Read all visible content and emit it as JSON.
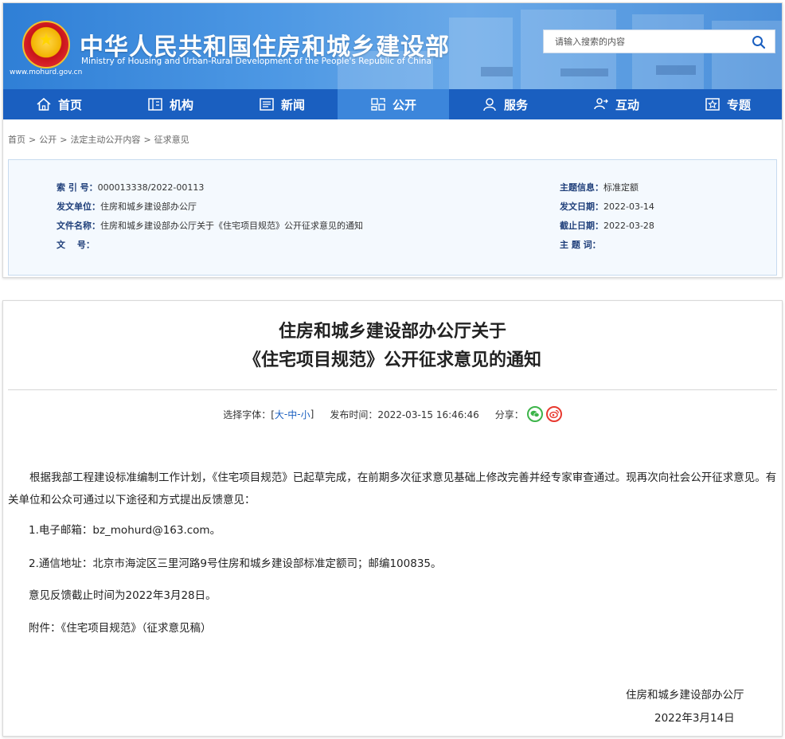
{
  "header": {
    "site_title": "中华人民共和国住房和城乡建设部",
    "site_title_en": "Ministry of Housing and Urban-Rural Development of the People's Republic of China",
    "site_url": "www.mohurd.gov.cn",
    "search_placeholder": "请输入搜索的内容",
    "search_icon": "search-icon"
  },
  "nav": {
    "items": [
      {
        "label": "首页",
        "icon": "home-icon"
      },
      {
        "label": "机构",
        "icon": "building-icon"
      },
      {
        "label": "新闻",
        "icon": "news-icon"
      },
      {
        "label": "公开",
        "icon": "public-icon",
        "active": true
      },
      {
        "label": "服务",
        "icon": "service-icon"
      },
      {
        "label": "互动",
        "icon": "interact-icon"
      },
      {
        "label": "专题",
        "icon": "topic-icon"
      }
    ],
    "active_color": "#3c86db",
    "bar_color": "#1a5fc0"
  },
  "breadcrumb": [
    "首页",
    "公开",
    "法定主动公开内容",
    "征求意见"
  ],
  "info": {
    "index_key": "索 引 号：",
    "index_value": "000013338/2022-00113",
    "topic_key": "主题信息：",
    "topic_value": "标准定额",
    "issuer_key": "发文单位：",
    "issuer_value": "住房和城乡建设部办公厅",
    "date_key": "发文日期：",
    "date_value": "2022-03-14",
    "docname_key": "文件名称：",
    "docname_value": "住房和城乡建设部办公厅关于《住宅项目规范》公开征求意见的通知",
    "deadline_key": "截止日期：",
    "deadline_value": "2022-03-28",
    "docno_key": "文　 号：",
    "docno_value": "",
    "keyword_key": "主 题 词：",
    "keyword_value": ""
  },
  "article": {
    "title_line1": "住房和城乡建设部办公厅关于",
    "title_line2": "《住宅项目规范》公开征求意见的通知",
    "font_label": "选择字体：[",
    "font_large": "大",
    "font_sep1": " - ",
    "font_medium": "中",
    "font_sep2": " - ",
    "font_small": "小",
    "font_close": "]",
    "publish_time": "发布时间：2022-03-15 16:46:46",
    "share_label": "分享：",
    "para1": "根据我部工程建设标准编制工作计划，《住宅项目规范》已起草完成，在前期多次征求意见基础上修改完善并经专家审查通过。现再次向社会公开征求意见。有关单位和公众可通过以下途径和方式提出反馈意见：",
    "item1": "1.电子邮箱：bz_mohurd@163.com。",
    "item2": "2.通信地址：北京市海淀区三里河路9号住房和城乡建设部标准定额司；邮编100835。",
    "deadline_text": "意见反馈截止时间为2022年3月28日。",
    "attachment": "附件：《住宅项目规范》（征求意见稿）",
    "sign_org": "住房和城乡建设部办公厅",
    "sign_date": "2022年3月14日"
  }
}
